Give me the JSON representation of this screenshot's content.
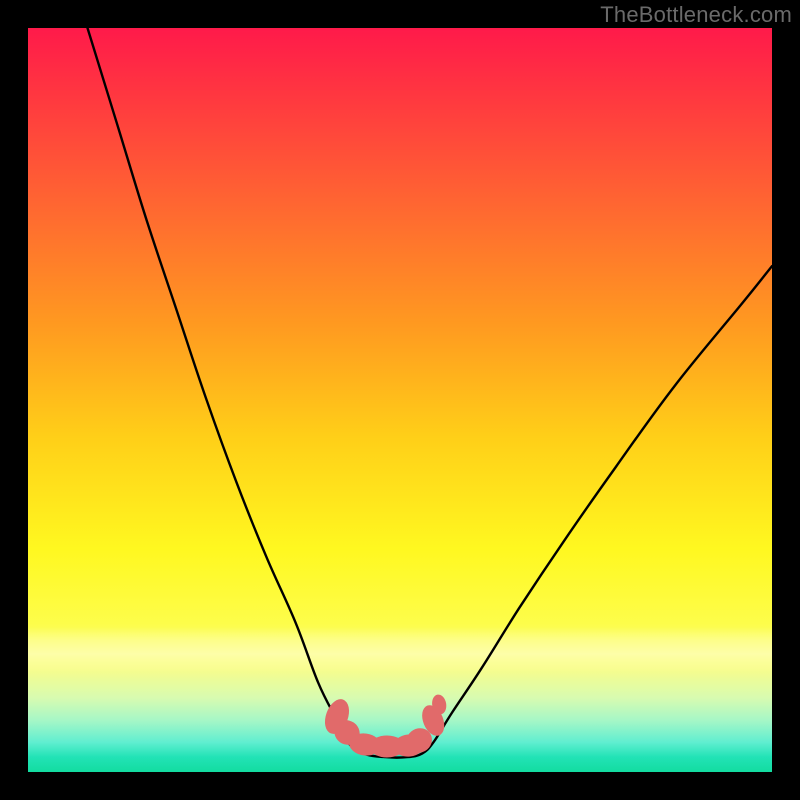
{
  "watermark": "TheBottleneck.com",
  "chart_data": {
    "type": "line",
    "title": "",
    "xlabel": "",
    "ylabel": "",
    "xlim": [
      0,
      100
    ],
    "ylim": [
      0,
      100
    ],
    "grid": false,
    "legend": false,
    "series": [
      {
        "name": "bottleneck-curve",
        "x": [
          8,
          12,
          16,
          20,
          24,
          28,
          32,
          36,
          39,
          41.5,
          43,
          45,
          48,
          51,
          53,
          54.5,
          57,
          61,
          66,
          72,
          79,
          87,
          96,
          100
        ],
        "y": [
          100,
          87,
          74,
          62,
          50,
          39,
          29,
          20,
          12,
          7,
          4,
          2.5,
          2,
          2,
          2.5,
          4,
          8,
          14,
          22,
          31,
          41,
          52,
          63,
          68
        ]
      }
    ],
    "annotations": [
      {
        "name": "valley-blob",
        "shape": "irregular",
        "approx_x_range": [
          41,
          55
        ],
        "approx_y_range": [
          2,
          7
        ],
        "color": "#e16a6a"
      }
    ],
    "background": {
      "type": "vertical-gradient",
      "stops": [
        {
          "pos": 0.0,
          "color": "#ff1a4a"
        },
        {
          "pos": 0.5,
          "color": "#ffc018"
        },
        {
          "pos": 0.8,
          "color": "#fdfd4a"
        },
        {
          "pos": 1.0,
          "color": "#13dca0"
        }
      ]
    }
  }
}
